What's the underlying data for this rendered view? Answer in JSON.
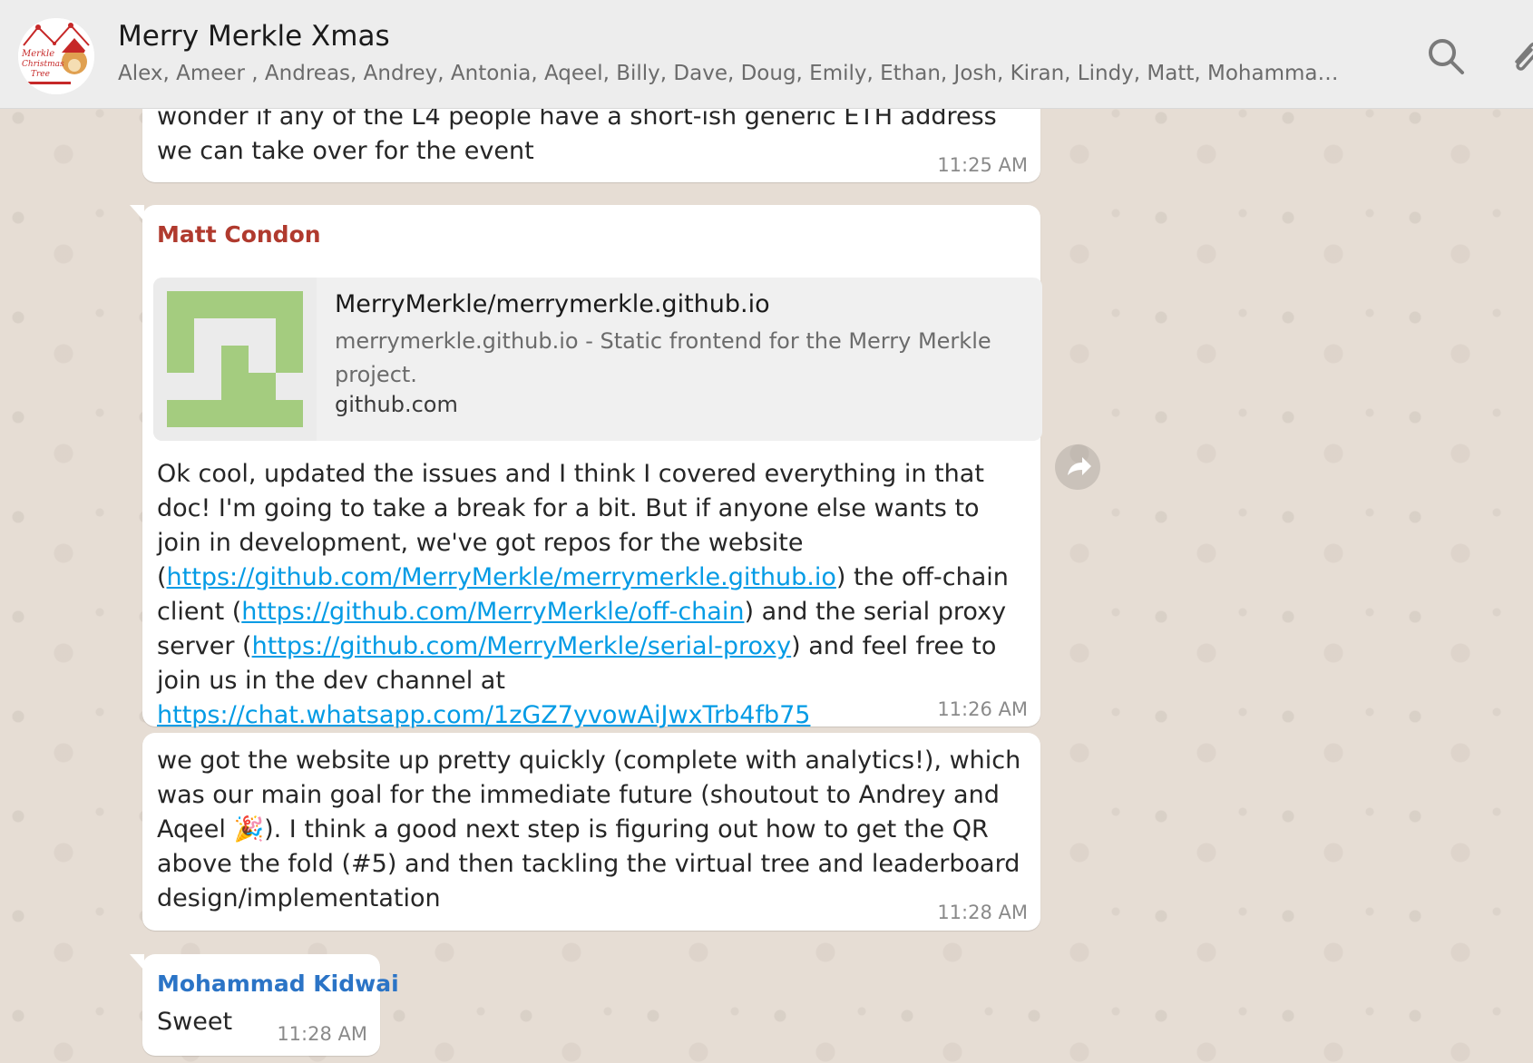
{
  "header": {
    "title": "Merry Merkle Xmas",
    "members": "Alex, Ameer , Andreas, Andrey, Antonia, Aqeel, Billy, Dave, Doug, Emily, Ethan, Josh, Kiran, Lindy, Matt, Mohammad, M...",
    "avatar_text_1": "Merkle",
    "avatar_text_2": "Christmas",
    "avatar_text_3": "Tree",
    "icons": [
      "search-icon",
      "attach-icon"
    ]
  },
  "messages": {
    "m1": {
      "text": "wonder if any of the L4 people have a short-ish generic ETH address we can take over for the event",
      "time": "11:25 AM"
    },
    "m2": {
      "sender": "Matt Condon",
      "sender_color": "#b03a2e",
      "preview": {
        "title": "MerryMerkle/merrymerkle.github.io",
        "description": "merrymerkle.github.io - Static frontend for the Merry Merkle project.",
        "domain": "github.com"
      },
      "text_1": "Ok cool, updated the issues and I think I covered everything in that doc! I'm going to take a break for a bit. But if anyone else wants to join in development, we've got repos for the website (",
      "link_1": "https://github.com/MerryMerkle/merrymerkle.github.io",
      "text_2": ") the off-chain client (",
      "link_2": "https://github.com/MerryMerkle/off-chain",
      "text_3": ") and the serial proxy server (",
      "link_3": "https://github.com/MerryMerkle/serial-proxy",
      "text_4": ") and feel free to join us in the dev channel at ",
      "link_4": "https://chat.whatsapp.com/1zGZ7yvowAiJwxTrb4fb75",
      "time": "11:26 AM"
    },
    "m3": {
      "text_1": "we got the website up pretty quickly (complete with analytics!), which was our main goal for the immediate future (shoutout to Andrey and Aqeel ",
      "emoji": "🎉",
      "text_2": "). I think a good next step is figuring out how to get the QR above the fold (#5) and then tackling the virtual tree and leaderboard design/implementation",
      "time": "11:28 AM"
    },
    "m4": {
      "sender": "Mohammad Kidwai",
      "sender_color": "#2b74c6",
      "text": "Sweet",
      "time": "11:28 AM"
    }
  },
  "colors": {
    "link": "#039be5",
    "chat_bg": "#e6ddd4",
    "header_bg": "#ededed"
  }
}
